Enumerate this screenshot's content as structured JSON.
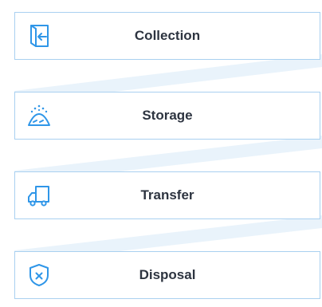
{
  "accent": "#2f96e8",
  "border": "#a9d0f0",
  "band": "#e9f3fb",
  "steps": [
    {
      "label": "Collection",
      "icon": "door-arrow-in-icon"
    },
    {
      "label": "Storage",
      "icon": "waste-pile-icon"
    },
    {
      "label": "Transfer",
      "icon": "truck-icon"
    },
    {
      "label": "Disposal",
      "icon": "shield-x-icon"
    }
  ]
}
